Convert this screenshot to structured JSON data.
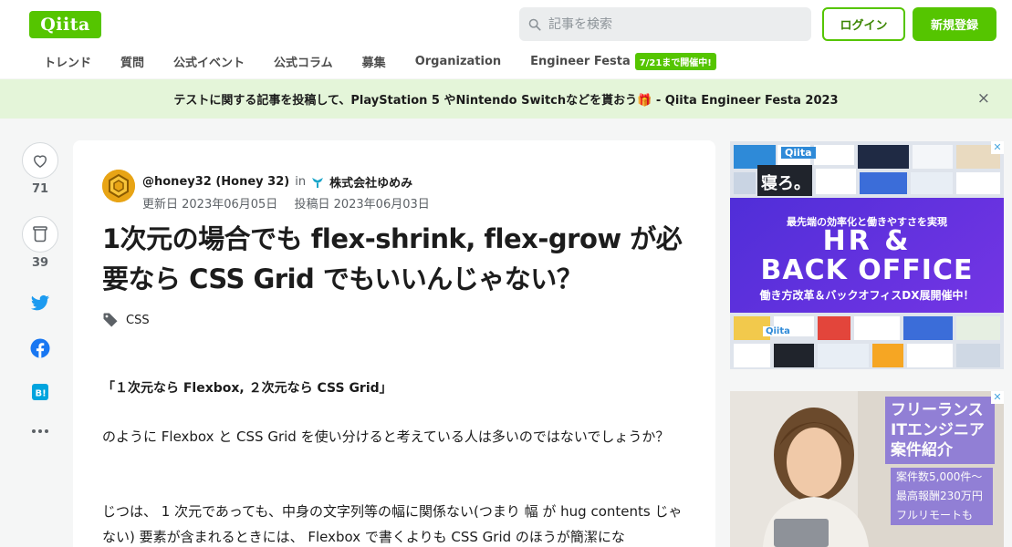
{
  "header": {
    "logo": "Qiita",
    "search_placeholder": "記事を検索",
    "login": "ログイン",
    "signup": "新規登録"
  },
  "nav": {
    "items": [
      "トレンド",
      "質問",
      "公式イベント",
      "公式コラム",
      "募集",
      "Organization",
      "Engineer Festa"
    ],
    "badge": "7/21まで開催中!"
  },
  "banner": {
    "text": "テストに関する記事を投稿して、PlayStation 5 やNintendo Switchなどを貰おう🎁 - Qiita Engineer Festa 2023",
    "close": "×"
  },
  "actions": {
    "likes": "71",
    "stocks": "39",
    "colors": {
      "twitter": "#1d9bf0",
      "facebook": "#1877f2",
      "hatena": "#00a4de"
    }
  },
  "article": {
    "author": "@honey32 (Honey 32)",
    "in": "in",
    "organization": "株式会社ゆめみ",
    "updated": "更新日 2023年06月05日",
    "posted": "投稿日 2023年06月03日",
    "title": "1次元の場合でも flex-shrink, flex-grow が必要なら CSS Grid でもいいんじゃない？",
    "tag": "CSS",
    "paragraphs": [
      "「１次元なら Flexbox, ２次元なら CSS Grid」",
      "のように Flexbox と CSS Grid を使い分けると考えている人は多いのではないでしょうか？",
      "じつは、 1 次元であっても、中身の文字列等の幅に関係ない(つまり 幅 が hug contents じゃない) 要素が含まれるときには、 Flexbox で書くよりも CSS Grid のほうが簡潔にな"
    ]
  },
  "ads": {
    "ad1": {
      "lines": [
        "最先端の効率化と働きやすさを実現",
        "HR &",
        "BACK OFFICE",
        "働き方改革＆バックオフィスDX展開催中！"
      ],
      "brand": "Qiita",
      "sleep_text": "寝ろ。"
    },
    "ad2": {
      "headline": [
        "フリーランス",
        "ITエンジニア",
        "案件紹介"
      ],
      "bullets": [
        "案件数5,000件〜",
        "最高報酬230万円",
        "フルリモートも"
      ]
    }
  }
}
